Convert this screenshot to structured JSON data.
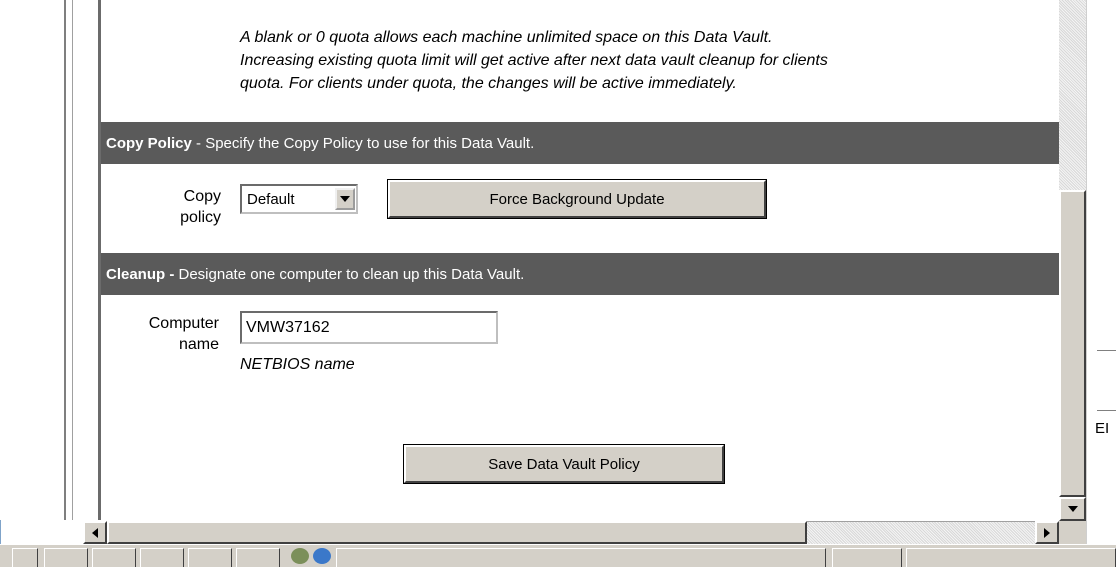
{
  "quota_note": {
    "line1": "A blank or 0 quota allows each machine unlimited space on this Data Vault.",
    "line2": "Increasing existing quota limit will get active after next data vault cleanup for clients",
    "line3": "quota. For clients under quota, the changes will be active immediately."
  },
  "copy_policy": {
    "header_bold": "Copy Policy",
    "header_desc": " - Specify the Copy Policy to use for this Data Vault.",
    "label_line1": "Copy",
    "label_line2": "policy",
    "selected_value": "Default",
    "force_button": "Force Background Update"
  },
  "cleanup": {
    "header_bold": "Cleanup -",
    "header_desc": " Designate one computer to clean up this Data Vault.",
    "label_line1": "Computer",
    "label_line2": "name",
    "computer_name_value": "VMW37162",
    "hint": "NETBIOS name"
  },
  "save_button": "Save Data Vault Policy",
  "right_edge_fragment": "EI",
  "colors": {
    "section_header_bg": "#5a5a5a",
    "button_face": "#d4d0c8",
    "frame_border": "#7fa3c9"
  },
  "icons": [
    "dropdown-arrow-icon",
    "scroll-down-arrow-icon",
    "scroll-left-arrow-icon",
    "scroll-right-arrow-icon"
  ]
}
